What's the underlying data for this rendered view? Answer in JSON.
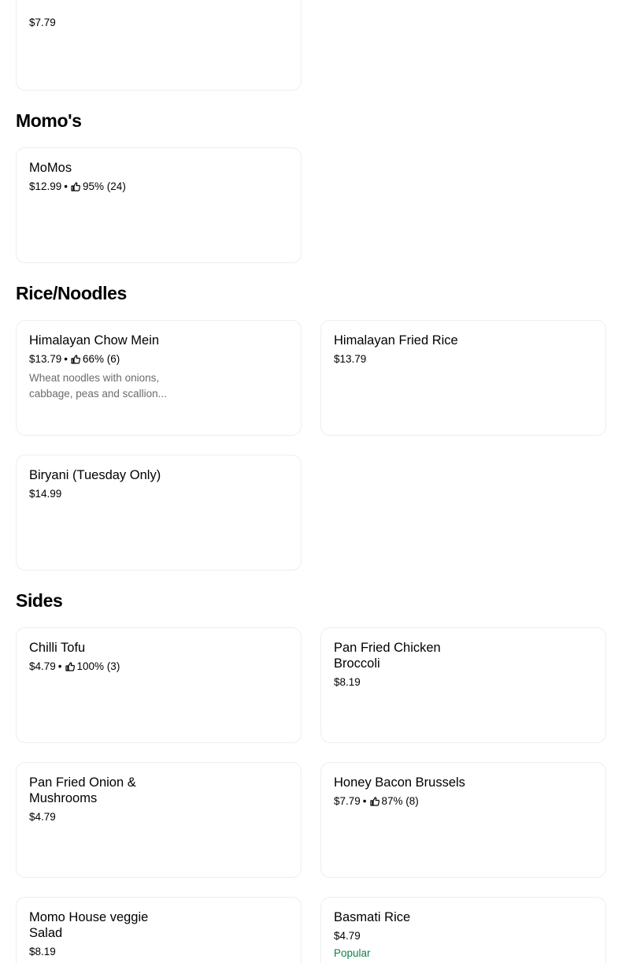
{
  "top_item": {
    "price": "$7.79"
  },
  "sections": [
    {
      "title": "Momo's",
      "items": [
        {
          "name": "MoMos",
          "price": "$12.99",
          "rating": "95% (24)"
        }
      ]
    },
    {
      "title": "Rice/Noodles",
      "items": [
        {
          "name": "Himalayan Chow Mein",
          "price": "$13.79",
          "rating": "66% (6)",
          "description": "Wheat noodles with onions, cabbage, peas and scallion..."
        },
        {
          "name": "Himalayan Fried Rice",
          "price": "$13.79"
        },
        {
          "name": "Biryani (Tuesday Only)",
          "price": "$14.99"
        }
      ]
    },
    {
      "title": "Sides",
      "items": [
        {
          "name": "Chilli Tofu",
          "price": "$4.79",
          "rating": "100% (3)"
        },
        {
          "name": "Pan Fried Chicken Broccoli",
          "price": "$8.19"
        },
        {
          "name": "Pan Fried Onion & Mushrooms",
          "price": "$4.79"
        },
        {
          "name": "Honey Bacon Brussels",
          "price": "$7.79",
          "rating": "87% (8)"
        },
        {
          "name": "Momo House veggie Salad",
          "price": "$8.19"
        },
        {
          "name": "Basmati Rice",
          "price": "$4.79",
          "badge": "Popular"
        }
      ]
    }
  ],
  "icons": {
    "rating": "thumbs-up-icon"
  },
  "colors": {
    "popular_badge": "#0e8345",
    "description": "#6b6b6b",
    "card_border": "#eeeeee"
  },
  "separator": "•"
}
